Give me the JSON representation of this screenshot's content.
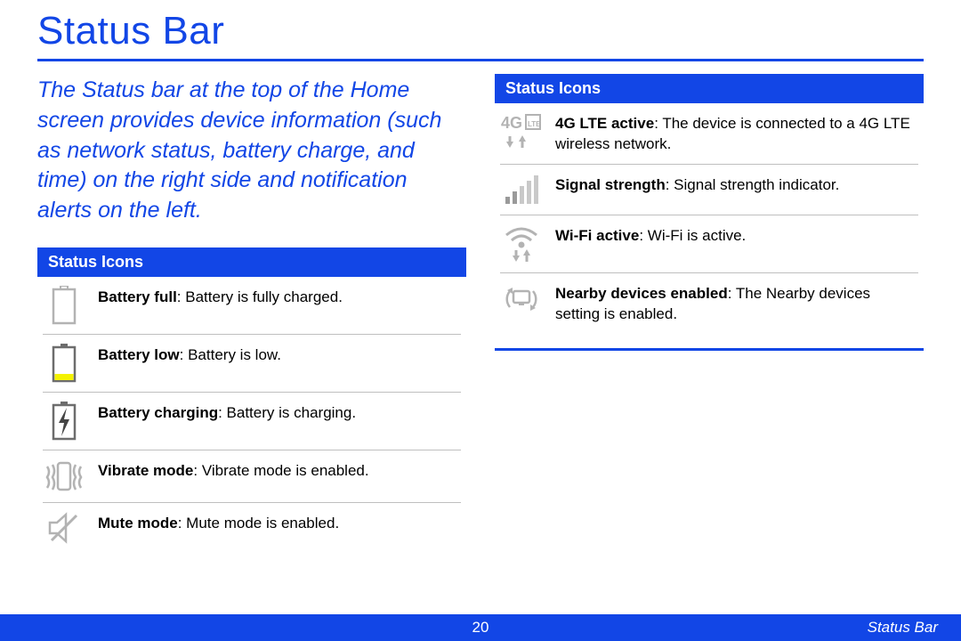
{
  "page": {
    "title": "Status Bar",
    "number": "20",
    "section_label": "Status Bar"
  },
  "intro": "The Status bar at the top of the Home screen provides device information (such as network status, battery charge, and time) on the right side and notification alerts on the left.",
  "left_section": {
    "heading": "Status Icons",
    "items": [
      {
        "icon": "battery-full-icon",
        "label": "Battery full",
        "text": ": Battery is fully charged."
      },
      {
        "icon": "battery-low-icon",
        "label": "Battery low",
        "text": ": Battery is low."
      },
      {
        "icon": "battery-charging-icon",
        "label": "Battery charging",
        "text": ": Battery is charging."
      },
      {
        "icon": "vibrate-mode-icon",
        "label": "Vibrate mode",
        "text": ": Vibrate mode is enabled."
      },
      {
        "icon": "mute-mode-icon",
        "label": "Mute mode",
        "text": ": Mute mode is enabled."
      }
    ]
  },
  "right_section": {
    "heading": "Status Icons",
    "items": [
      {
        "icon": "4g-lte-icon",
        "label": "4G LTE active",
        "text": ": The device is connected to a 4G LTE wireless network."
      },
      {
        "icon": "signal-strength-icon",
        "label": "Signal strength",
        "text": ": Signal strength indicator."
      },
      {
        "icon": "wifi-active-icon",
        "label": "Wi-Fi active",
        "text": ": Wi-Fi is active."
      },
      {
        "icon": "nearby-devices-icon",
        "label": "Nearby devices enabled",
        "text": ": The Nearby devices setting is enabled."
      }
    ]
  }
}
